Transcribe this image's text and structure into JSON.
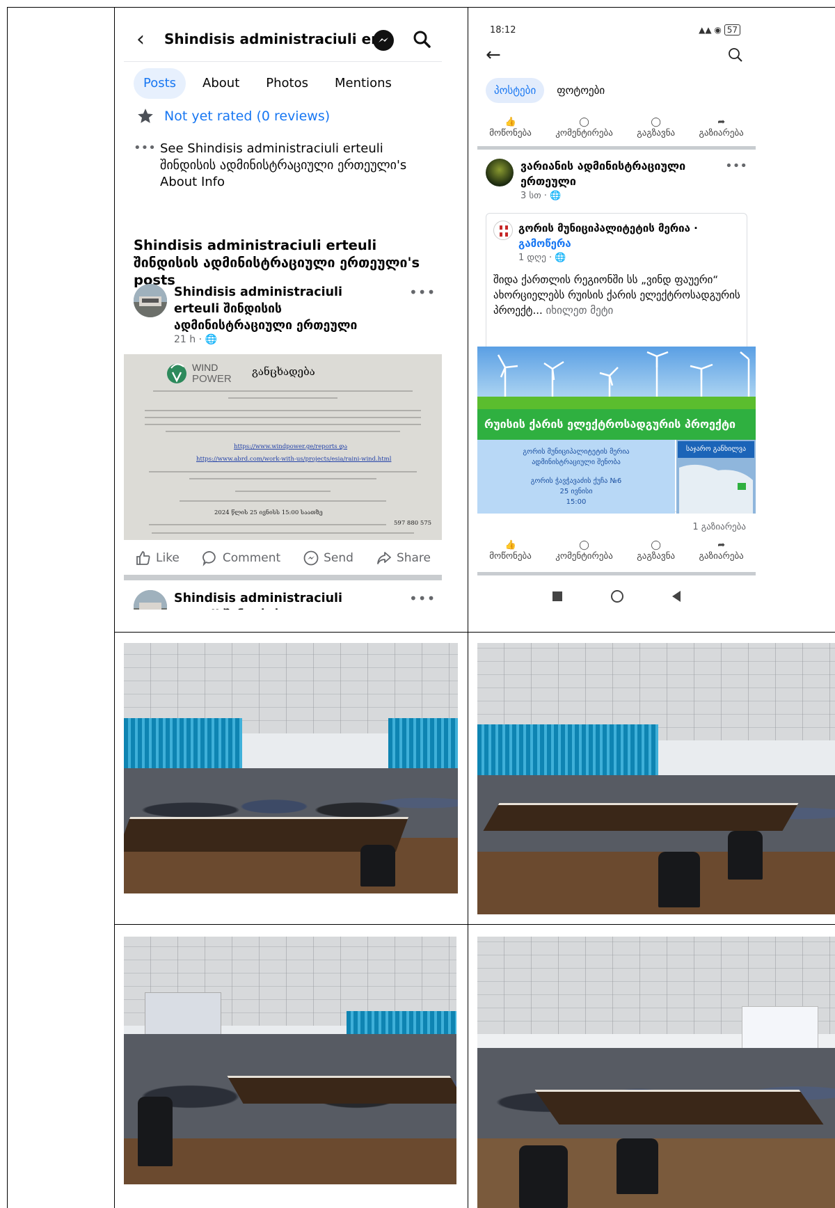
{
  "left_screenshot": {
    "page_title": "Shindisis administraciuli er...",
    "tabs": [
      "Posts",
      "About",
      "Photos",
      "Mentions"
    ],
    "active_tab": "Posts",
    "rating": "Not yet rated (0 reviews)",
    "about_info": "See Shindisis administraciuli erteuli შინდისის ადმინისტრაციული ერთეული's About Info",
    "posts_heading": "Shindisis administraciuli erteuli შინდისის ადმინისტრაციული ერთეული's posts",
    "post": {
      "author": "Shindisis administraciuli erteuli შინდისის ადმინისტრაციული ერთეული",
      "time": "21 h · ",
      "image": {
        "logo_word1": "WIND",
        "logo_word2": "POWER",
        "title": "განცხადება",
        "link1": "https://www.windpower.ge/reports და",
        "link2": "https://www.abrd.com/work-with-us/projects/esia/raini-wind.html",
        "note1": "2024 წლის 25 ივნისს 15:00 საათზე",
        "note2": "597 880 575"
      }
    },
    "actions": [
      "Like",
      "Comment",
      "Send",
      "Share"
    ],
    "post2_author": "Shindisis administraciuli erteuli შინდისის ადმინისტრაციული"
  },
  "right_screenshot": {
    "status_time": "18:12",
    "battery": "57",
    "tabs": [
      "პოსტები",
      "ფოტოები"
    ],
    "active_tab": "პოსტები",
    "actions": [
      "მოწონება",
      "კომენტირება",
      "გაგზავნა",
      "გაზიარება"
    ],
    "post": {
      "author": "ვარიანის ადმინისტრაციული ერთეული",
      "time": "3 სთ · "
    },
    "shared": {
      "author": "გორის მუნიციპალიტეტის მერია · ",
      "follow": "გამოწერა",
      "time": "1 დღე · ",
      "text": "შიდა ქართლის რეგიონში სს „ვინდ ფაუერი“ ახორციელებს რუისის ქარის ელექტროსადგურის პროექტ... ",
      "see_more": "იხილეთ მეტი"
    },
    "banner": {
      "headline": "რუისის ქარის ელექტროსადგურის პროექტი",
      "info_line1": "გორის მუნიციპალიტეტის მერია",
      "info_line2": "ადმინისტრაციული შენობა",
      "info_line3": "გორის ჭავჭავაძის ქუჩა №6",
      "info_line4": "25 ივნისი",
      "info_line5": "15:00",
      "map_label": "საჯარო განხილვა"
    },
    "shares": "1 გაზიარება"
  },
  "colors": {
    "fb_blue": "#1877f2",
    "text_gray": "#65676b",
    "banner_green": "#2fb040"
  }
}
